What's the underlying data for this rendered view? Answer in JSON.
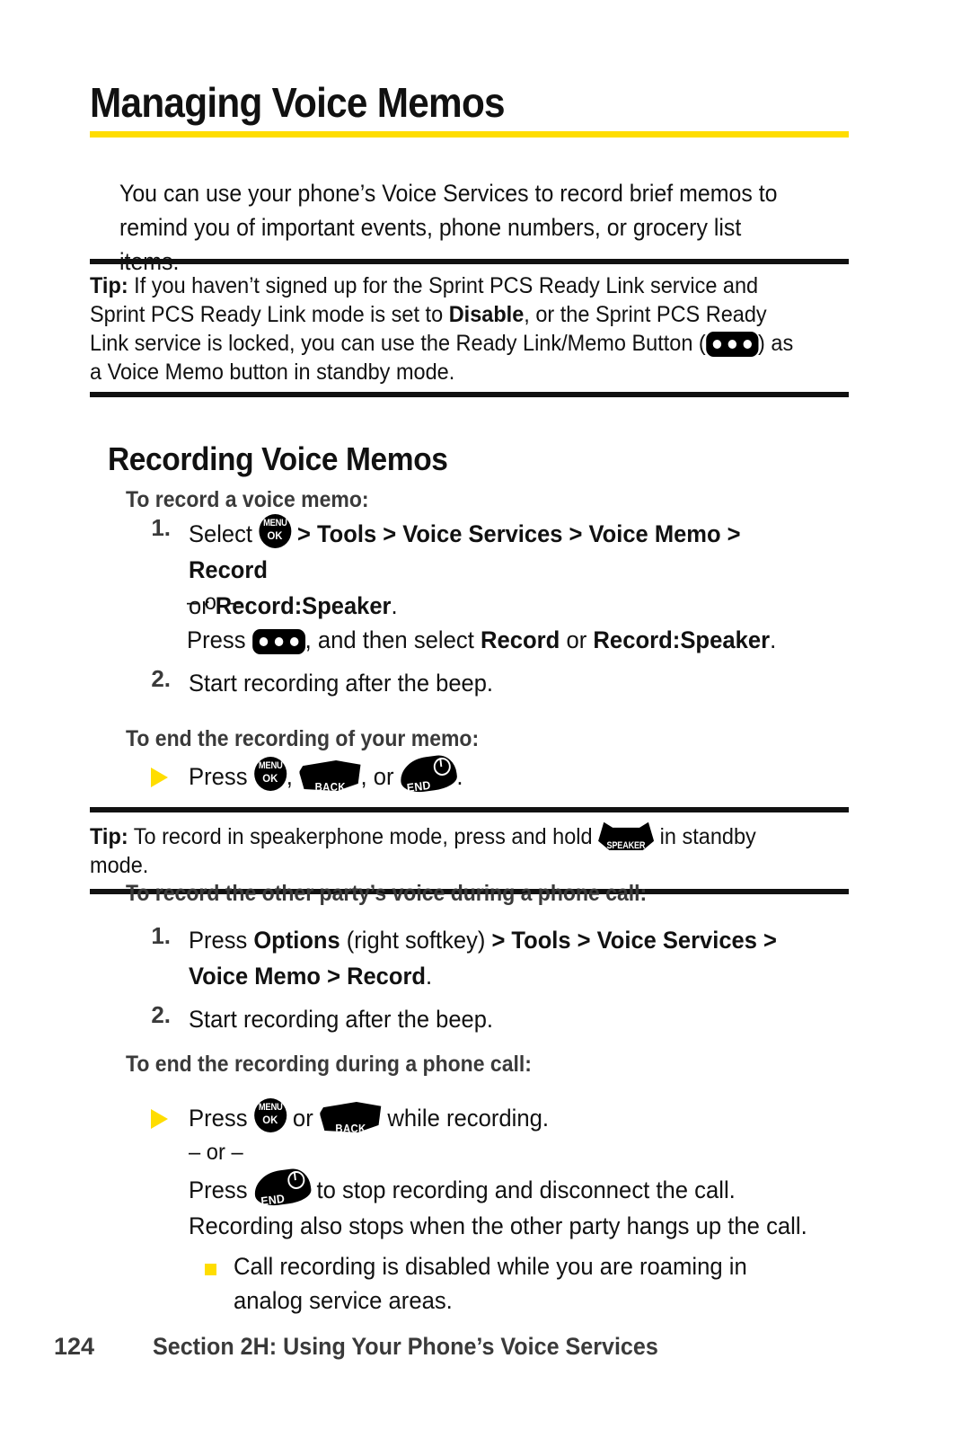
{
  "page": {
    "title": "Managing Voice Memos",
    "accent_color": "#FFDD00",
    "rule_color": "#111111"
  },
  "intro": {
    "line1": "You can use your phone’s Voice Services to record brief memos to",
    "line2": "remind you of important events, phone numbers, or grocery list items."
  },
  "tip1": {
    "lead": "Tip:",
    "part1": " If you haven’t signed up for the Sprint PCS Ready Link service and Sprint PCS Ready Link mode is set to ",
    "bold1": "Disable",
    "part2": ", or the Sprint PCS Ready Link service is locked, you can use the Ready Link/Memo Button (",
    "part3": ") as a Voice Memo button in standby mode.",
    "icon": "ready-link-memo-button-icon"
  },
  "section_recording": {
    "heading": "Recording Voice Memos",
    "sub1": "To record a voice memo:",
    "step1": {
      "num": "1.",
      "pre": "Select ",
      "icon": "menu-ok-key-icon",
      "nav": " > Tools > Voice Services > Voice Memo > Record",
      "nav_items": [
        "Tools",
        "Voice Services",
        "Voice Memo",
        "Record"
      ],
      "line2_pre": "or ",
      "line2_bold": "Record:Speaker",
      "line2_post": "."
    },
    "or_divider": "– or –",
    "alt_press": {
      "pre": "Press ",
      "icon": "ready-link-memo-button-icon",
      "mid": ", and then select ",
      "bold1": "Record",
      "joiner": " or ",
      "bold2": "Record:Speaker",
      "post": "."
    },
    "step2": {
      "num": "2.",
      "text": "Start recording after the beep."
    },
    "sub2": "To end the recording of your memo:",
    "end_memo": {
      "pre": "Press ",
      "icon1": "menu-ok-key-icon",
      "sep1": ", ",
      "icon2": "back-key-icon",
      "sep2": ", or ",
      "icon3": "end-key-icon",
      "post": "."
    }
  },
  "tip2": {
    "lead": "Tip:",
    "part1": " To record in speakerphone mode, press and hold ",
    "icon": "speaker-key-icon",
    "part2": " in standby mode."
  },
  "section_call": {
    "sub1": "To record the other party’s voice during a phone call:",
    "step1": {
      "num": "1.",
      "pre": "Press ",
      "bold1": "Options",
      "mid": " (right softkey) ",
      "nav": "> Tools > Voice Services >",
      "line2_bold": "Voice Memo > Record",
      "line2_post": "."
    },
    "step2": {
      "num": "2.",
      "text": "Start recording after the beep."
    },
    "sub2": "To end the recording during a phone call:",
    "end_call": {
      "pre": "Press ",
      "icon1": "menu-ok-key-icon",
      "joiner": " or ",
      "icon2": "back-key-icon",
      "post": " while recording."
    },
    "or_divider": "– or –",
    "end_press": {
      "pre": "Press ",
      "icon": "end-key-icon",
      "post": " to stop recording and disconnect the call."
    },
    "note": "Recording also stops when the other party hangs up the call.",
    "bullet1_line1": "Call recording is disabled while you are roaming in",
    "bullet1_line2": "analog service areas."
  },
  "footer": {
    "page_number": "124",
    "section_text": "Section 2H: Using Your Phone’s Voice Services"
  },
  "icon_labels": {
    "menu": "MENU",
    "ok": "OK",
    "back": "BACK",
    "end": "END",
    "speaker": "SPEAKER"
  }
}
